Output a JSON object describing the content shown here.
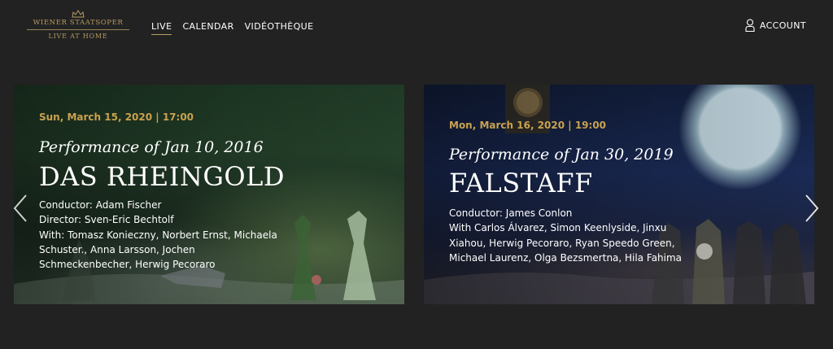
{
  "brand": {
    "top": "WIENER STAATSOPER",
    "bottom": "LIVE AT HOME"
  },
  "nav": {
    "items": [
      {
        "label": "LIVE"
      },
      {
        "label": "CALENDAR"
      },
      {
        "label": "VIDÉOTHÈQUE"
      }
    ],
    "active_index": 0
  },
  "account": {
    "label": "ACCOUNT",
    "icon": "user-icon"
  },
  "colors": {
    "background": "#222222",
    "accent_gold": "#c9a24f",
    "text": "#ffffff"
  },
  "cards": [
    {
      "date": "Sun, March 15, 2020 | 17:00",
      "performance": "Performance of Jan 10, 2016",
      "title": "DAS RHEINGOLD",
      "credits": [
        "Conductor: Adam Fischer",
        "Director: Sven-Eric Bechtolf",
        "With: Tomasz Konieczny, Norbert Ernst, Michaela",
        "Schuster., Anna Larsson, Jochen",
        "Schmeckenbecher,  Herwig Pecoraro"
      ]
    },
    {
      "date": "Mon, March 16, 2020 | 19:00",
      "performance": "Performance of Jan 30, 2019",
      "title": "FALSTAFF",
      "credits": [
        "Conductor: James Conlon",
        "With Carlos Álvarez, Simon Keenlyside, Jinxu",
        "Xiahou, Herwig Pecoraro, Ryan Speedo Green,",
        "Michael Laurenz, Olga Bezsmertna, Hila Fahima"
      ]
    }
  ],
  "carousel": {
    "prev_icon": "chevron-left-icon",
    "next_icon": "chevron-right-icon"
  }
}
